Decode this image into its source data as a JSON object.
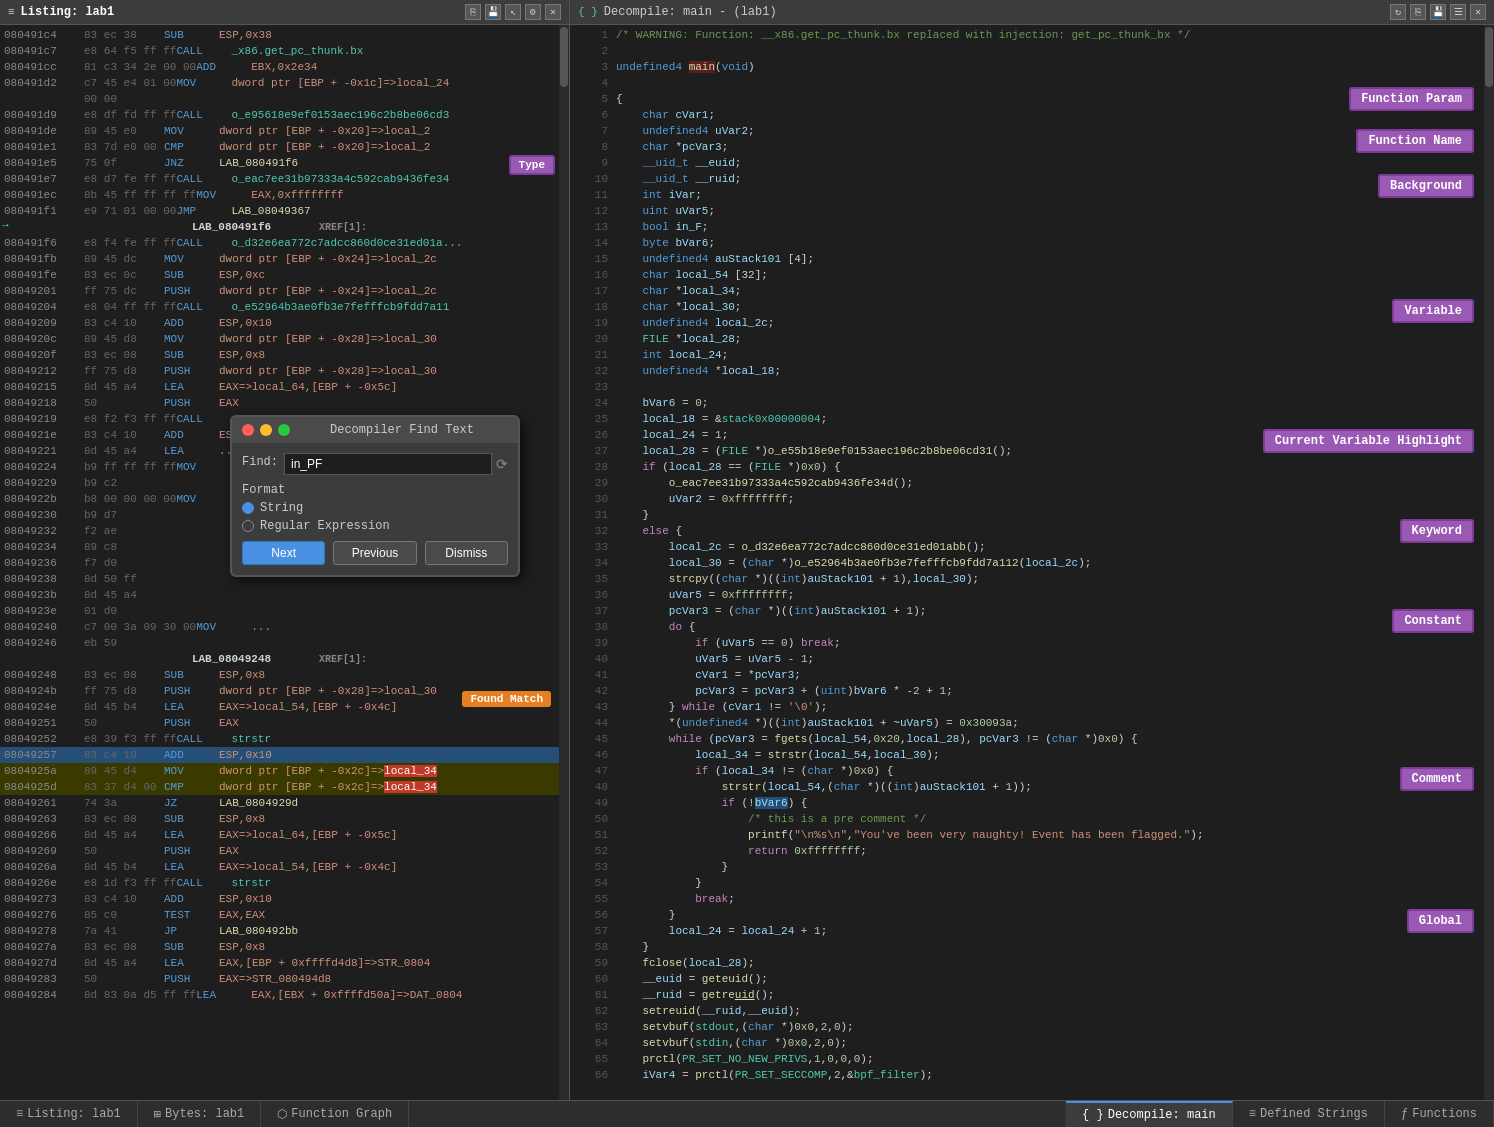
{
  "leftPanel": {
    "title": "Listing: lab1",
    "rows": [
      {
        "addr": "080491c4",
        "bytes": "83 ec 38",
        "mnem": "SUB",
        "operand": "ESP,0x38",
        "type": "normal"
      },
      {
        "addr": "080491c7",
        "bytes": "e8 64 f5 ff ff",
        "mnem": "CALL",
        "operand": "_x86.get_pc_thunk.bx",
        "type": "call"
      },
      {
        "addr": "080491cc",
        "bytes": "81 c3 34 2e 00 00",
        "mnem": "ADD",
        "operand": "EBX,0x2e34",
        "type": "normal"
      },
      {
        "addr": "080491d2",
        "bytes": "c7 45 e4 01 00",
        "mnem": "MOV",
        "operand": "dword ptr [EBP + -0x1c]=>local_24",
        "type": "normal"
      },
      {
        "addr": "",
        "bytes": "00 00",
        "mnem": "",
        "operand": "",
        "type": "continuation"
      },
      {
        "addr": "080491d9",
        "bytes": "e8 df fd ff ff",
        "mnem": "CALL",
        "operand": "o_e95618e9ef0153aec196c2b8be06cd3",
        "type": "call2"
      },
      {
        "addr": "080491de",
        "bytes": "89 45 e0",
        "mnem": "MOV",
        "operand": "dword ptr [EBP + -0x20]=>local_28",
        "type": "normal"
      },
      {
        "addr": "080491e1",
        "bytes": "83 7d e0 00",
        "mnem": "CMP",
        "operand": "dword ptr [EBP + -0x20]=>local_28",
        "type": "normal"
      },
      {
        "addr": "080491e5",
        "bytes": "75 0f",
        "mnem": "JNZ",
        "operand": "LAB_080491f6",
        "type": "normal"
      },
      {
        "addr": "080491e7",
        "bytes": "e8 d7 fe ff ff",
        "mnem": "CALL",
        "operand": "o_eac7ee31b97333a4c592cab9436fe34",
        "type": "call2"
      },
      {
        "addr": "080491ec",
        "bytes": "8b 45 ff ff ff ff",
        "mnem": "MOV",
        "operand": "EAX,0xffffffff",
        "type": "normal"
      },
      {
        "addr": "080491f1",
        "bytes": "e9 71 01 00 00",
        "mnem": "JMP",
        "operand": "LAB_08049367",
        "type": "normal"
      },
      {
        "label": "LAB_080491f6",
        "xref": "XREF[1]:",
        "type": "label"
      },
      {
        "addr": "080491f6",
        "bytes": "e8 f4 fe ff ff",
        "mnem": "CALL",
        "operand": "o_d32e6ea772c7adcc860d0ce31ed01a8",
        "type": "call2"
      },
      {
        "addr": "080491fb",
        "bytes": "89 45 dc",
        "mnem": "MOV",
        "operand": "dword ptr [EBP + -0x24]=>local_2c",
        "type": "normal"
      },
      {
        "addr": "080491fe",
        "bytes": "83 ec 0c",
        "mnem": "SUB",
        "operand": "ESP,0xc",
        "type": "normal"
      },
      {
        "addr": "08049201",
        "bytes": "ff 75 dc",
        "mnem": "PUSH",
        "operand": "dword ptr [EBP + -0x24]=>local_2c",
        "type": "normal"
      },
      {
        "addr": "08049204",
        "bytes": "e8 04 ff ff ff",
        "mnem": "CALL",
        "operand": "o_e52964b3ae0fb3e7fefffcb9fdd7a11",
        "type": "call2"
      },
      {
        "addr": "08049209",
        "bytes": "83 c4 10",
        "mnem": "ADD",
        "operand": "ESP,0x10",
        "type": "normal"
      },
      {
        "addr": "0804920c",
        "bytes": "89 45 d8",
        "mnem": "MOV",
        "operand": "dword ptr [EBP + -0x28]=>local_30",
        "type": "normal"
      },
      {
        "addr": "0804920f",
        "bytes": "83 ec 08",
        "mnem": "SUB",
        "operand": "ESP,0x8",
        "type": "normal"
      },
      {
        "addr": "08049212",
        "bytes": "ff 75 d8",
        "mnem": "PUSH",
        "operand": "dword ptr [EBP + -0x28]=>local_30",
        "type": "normal"
      },
      {
        "addr": "08049215",
        "bytes": "8d 45 a4",
        "mnem": "LEA",
        "operand": "EAX=>local_64,[EBP + -0x5c]",
        "type": "normal"
      },
      {
        "addr": "08049218",
        "bytes": "50",
        "mnem": "PUSH",
        "operand": "EAX",
        "type": "normal"
      },
      {
        "addr": "08049219",
        "bytes": "e8 f2 f3 ff ff",
        "mnem": "CALL",
        "operand": "strcpy",
        "type": "call"
      },
      {
        "addr": "0804921e",
        "bytes": "83 c4 10",
        "mnem": "ADD",
        "operand": "ESP,0x10",
        "type": "normal"
      },
      {
        "addr": "08049221",
        "bytes": "8d 45 a4",
        "mnem": "LEA",
        "operand": "...",
        "type": "normal"
      },
      {
        "addr": "08049224",
        "bytes": "b9 ff ff ff ff",
        "mnem": "MOV",
        "operand": "...",
        "type": "normal"
      },
      {
        "addr": "08049229",
        "bytes": "b9 c2",
        "mnem": "",
        "operand": "",
        "type": "normal"
      },
      {
        "addr": "0804922b",
        "bytes": "b9 c2",
        "mnem": "",
        "operand": "",
        "type": "normal"
      },
      {
        "addr": "0804922b",
        "bytes": "b8 00 00 00 00",
        "mnem": "MOV",
        "operand": "...",
        "type": "normal"
      },
      {
        "addr": "08049230",
        "bytes": "b9 d7",
        "mnem": "",
        "operand": "",
        "type": "normal"
      },
      {
        "addr": "08049232",
        "bytes": "f2 ae",
        "mnem": "",
        "operand": "",
        "type": "normal"
      },
      {
        "addr": "08049234",
        "bytes": "89 c8",
        "mnem": "",
        "operand": "",
        "type": "normal"
      },
      {
        "addr": "08049236",
        "bytes": "f7 d0",
        "mnem": "",
        "operand": "",
        "type": "normal"
      },
      {
        "addr": "08049238",
        "bytes": "8d 50 ff",
        "mnem": "",
        "operand": "",
        "type": "normal"
      },
      {
        "addr": "0804923b",
        "bytes": "8d 45 a4",
        "mnem": "",
        "operand": "",
        "type": "normal"
      },
      {
        "addr": "0804923e",
        "bytes": "01 d0",
        "mnem": "",
        "operand": "",
        "type": "normal"
      },
      {
        "addr": "08049240",
        "bytes": "c7 00 3a 09 30 00",
        "mnem": "MOV",
        "operand": "...",
        "type": "normal"
      },
      {
        "addr": "08049246",
        "bytes": "eb 59",
        "mnem": "",
        "operand": "",
        "type": "normal"
      },
      {
        "label": "LAB_08049248",
        "xref": "XREF[1]:",
        "type": "label"
      },
      {
        "addr": "08049248",
        "bytes": "83 ec 08",
        "mnem": "SUB",
        "operand": "ESP,0x8",
        "type": "normal"
      },
      {
        "addr": "0804924b",
        "bytes": "ff 75 d8",
        "mnem": "PUSH",
        "operand": "dword ptr [EBP + -0x28]=>local_30",
        "type": "normal"
      },
      {
        "addr": "0804924e",
        "bytes": "8d 45 b4",
        "mnem": "LEA",
        "operand": "EAX=>local_54,[EBP + -0x4c]",
        "type": "normal"
      },
      {
        "addr": "08049251",
        "bytes": "50",
        "mnem": "PUSH",
        "operand": "EAX",
        "type": "normal"
      },
      {
        "addr": "08049252",
        "bytes": "e8 39 f3 ff ff",
        "mnem": "CALL",
        "operand": "strstr",
        "type": "call"
      },
      {
        "addr": "08049257",
        "bytes": "83 c4 10",
        "mnem": "ADD",
        "operand": "ESP,0x10",
        "type": "normal"
      },
      {
        "addr": "0804925a",
        "bytes": "89 45 d4",
        "mnem": "MOV",
        "operand": "dword ptr [EBP + -0x2c]=>local_34",
        "type": "normal",
        "highlighted": true
      },
      {
        "addr": "0804925d",
        "bytes": "83 37 d4 00",
        "mnem": "CMP",
        "operand": "dword ptr [EBP + -0x2c]=>local_34",
        "type": "normal",
        "highlighted": true
      },
      {
        "addr": "08049261",
        "bytes": "74 3a",
        "mnem": "JZ",
        "operand": "LAB_0804929d",
        "type": "normal"
      },
      {
        "addr": "08049263",
        "bytes": "83 ec 08",
        "mnem": "SUB",
        "operand": "ESP,0x8",
        "type": "normal"
      },
      {
        "addr": "08049266",
        "bytes": "8d 45 a4",
        "mnem": "LEA",
        "operand": "EAX=>local_64,[EBP + -0x5c]",
        "type": "normal"
      },
      {
        "addr": "08049269",
        "bytes": "50",
        "mnem": "PUSH",
        "operand": "EAX",
        "type": "normal"
      },
      {
        "addr": "0804926a",
        "bytes": "8d 45 b4",
        "mnem": "LEA",
        "operand": "EAX=>local_54,[EBP + -0x4c]",
        "type": "normal"
      },
      {
        "addr": "0804926e",
        "bytes": "50",
        "mnem": "PUSH",
        "operand": "EAX",
        "type": "normal"
      },
      {
        "addr": "0804926e",
        "bytes": "e8 1d f3 ff ff",
        "mnem": "CALL",
        "operand": "strstr",
        "type": "call"
      },
      {
        "addr": "08049273",
        "bytes": "83 c4 10",
        "mnem": "ADD",
        "operand": "ESP,0x10",
        "type": "normal"
      },
      {
        "addr": "08049276",
        "bytes": "85 c0",
        "mnem": "TEST",
        "operand": "EAX,EAX",
        "type": "normal"
      },
      {
        "addr": "08049278",
        "bytes": "7a 41",
        "mnem": "JP",
        "operand": "LAB_080492bb",
        "type": "normal"
      },
      {
        "addr": "0804927a",
        "bytes": "83 ec 08",
        "mnem": "SUB",
        "operand": "ESP,0x8",
        "type": "normal"
      },
      {
        "addr": "0804927d",
        "bytes": "8d 45 a4",
        "mnem": "LEA",
        "operand": "EAX,[EBP + 0xffffd4d8]=>STR_0804",
        "type": "normal"
      },
      {
        "addr": "08049283",
        "bytes": "50",
        "mnem": "PUSH",
        "operand": "EAX=>STR_080494d8",
        "type": "normal"
      },
      {
        "addr": "08049284",
        "bytes": "8d 83 0a d5 ff ff",
        "mnem": "LEA",
        "operand": "EAX,[EBX + 0xffffd50a]=>DAT_0804",
        "type": "normal"
      }
    ]
  },
  "rightPanel": {
    "title": "Decompile: main - (lab1)",
    "lines": [
      {
        "num": 1,
        "content": "/* WARNING: Function: __x86.get_pc_thunk.bx replaced with injection: get_pc_thunk_bx */",
        "type": "comment"
      },
      {
        "num": 2,
        "content": "",
        "type": "blank"
      },
      {
        "num": 3,
        "content": "undefined4 main(void)",
        "type": "funcdef"
      },
      {
        "num": 4,
        "content": "",
        "type": "blank"
      },
      {
        "num": 5,
        "content": "{",
        "type": "punc"
      },
      {
        "num": 6,
        "content": "    char cVar1;",
        "type": "decl"
      },
      {
        "num": 7,
        "content": "    undefined4 uVar2;",
        "type": "decl"
      },
      {
        "num": 8,
        "content": "    char *pcVar3;",
        "type": "decl"
      },
      {
        "num": 9,
        "content": "    __uid_t __euid;",
        "type": "decl"
      },
      {
        "num": 10,
        "content": "    __uid_t __ruid;",
        "type": "decl"
      },
      {
        "num": 11,
        "content": "    int iVar;",
        "type": "decl"
      },
      {
        "num": 12,
        "content": "    uint uVar5;",
        "type": "decl"
      },
      {
        "num": 13,
        "content": "    bool in_F;",
        "type": "decl"
      },
      {
        "num": 14,
        "content": "    byte bVar6;",
        "type": "decl"
      },
      {
        "num": 15,
        "content": "    undefined4 auStack101 [4];",
        "type": "decl"
      },
      {
        "num": 16,
        "content": "    char local_54 [32];",
        "type": "decl"
      },
      {
        "num": 17,
        "content": "    char *local_34;",
        "type": "decl"
      },
      {
        "num": 18,
        "content": "    char *local_30;",
        "type": "decl"
      },
      {
        "num": 19,
        "content": "    undefined4 local_2c;",
        "type": "decl"
      },
      {
        "num": 20,
        "content": "    FILE *local_28;",
        "type": "decl"
      },
      {
        "num": 21,
        "content": "    int local_24;",
        "type": "decl"
      },
      {
        "num": 22,
        "content": "    undefined4 *local_18;",
        "type": "decl"
      },
      {
        "num": 23,
        "content": "",
        "type": "blank"
      },
      {
        "num": 24,
        "content": "    bVar6 = 0;",
        "type": "code"
      },
      {
        "num": 25,
        "content": "    local_18 = &stack0x00000004;",
        "type": "code"
      },
      {
        "num": 26,
        "content": "    local_24 = 1;",
        "type": "code"
      },
      {
        "num": 27,
        "content": "    local_28 = (FILE *)o_e55b18e9ef0153aec196c2b8be06cd31();",
        "type": "code"
      },
      {
        "num": 28,
        "content": "    if (local_28 == (FILE *)0x0) {",
        "type": "ctrl"
      },
      {
        "num": 29,
        "content": "        o_eac7ee31b97333a4c592cab9436fe34d();",
        "type": "code"
      },
      {
        "num": 30,
        "content": "        uVar2 = 0xffffffff;",
        "type": "code"
      },
      {
        "num": 31,
        "content": "    }",
        "type": "punc"
      },
      {
        "num": 32,
        "content": "    else {",
        "type": "ctrl"
      },
      {
        "num": 33,
        "content": "        local_2c = o_d32e6ea772c7adcc860d0ce31ed01abb();",
        "type": "code"
      },
      {
        "num": 34,
        "content": "        local_30 = (char *)o_e52964b3ae0fb3e7fefffcb9fdd7a112(local_2c);",
        "type": "code"
      },
      {
        "num": 35,
        "content": "        strcpy((char *)((int)auStack101 + 1),local_30);",
        "type": "code"
      },
      {
        "num": 36,
        "content": "        uVar5 = 0xffffffff;",
        "type": "code"
      },
      {
        "num": 37,
        "content": "        pcVar3 = (char *)((int)auStack101 + 1);",
        "type": "code"
      },
      {
        "num": 38,
        "content": "        do {",
        "type": "ctrl"
      },
      {
        "num": 39,
        "content": "            if (uVar5 == 0) break;",
        "type": "ctrl"
      },
      {
        "num": 40,
        "content": "            uVar5 = uVar5 - 1;",
        "type": "code"
      },
      {
        "num": 41,
        "content": "            cVar1 = *pcVar3;",
        "type": "code"
      },
      {
        "num": 42,
        "content": "            pcVar3 = pcVar3 + (uint)bVar6 * -2 + 1;",
        "type": "code"
      },
      {
        "num": 43,
        "content": "        } while (cVar1 != '\\0');",
        "type": "ctrl"
      },
      {
        "num": 44,
        "content": "        *(undefined4 *)((int)auStack101 + ~uVar5) = 0x30093a;",
        "type": "code"
      },
      {
        "num": 45,
        "content": "        while (pcVar3 = fgets(local_54,0x20,local_28), pcVar3 != (char *)0x0) {",
        "type": "ctrl"
      },
      {
        "num": 46,
        "content": "            local_34 = strstr(local_54,local_30);",
        "type": "code"
      },
      {
        "num": 47,
        "content": "            if (local_34 != (char *)0x0) {",
        "type": "ctrl"
      },
      {
        "num": 48,
        "content": "                strstr(local_54,(char *)((int)auStack101 + 1));",
        "type": "code"
      },
      {
        "num": 49,
        "content": "                if (!bVar6) {",
        "type": "ctrl"
      },
      {
        "num": 50,
        "content": "                    /* this is a pre comment */",
        "type": "comment"
      },
      {
        "num": 51,
        "content": "                    printf(\"\\n%s\\n\",\"You've been very naughty! Event has been flagged.\");",
        "type": "code"
      },
      {
        "num": 52,
        "content": "                    return 0xffffffff;",
        "type": "code"
      },
      {
        "num": 53,
        "content": "                }",
        "type": "punc"
      },
      {
        "num": 54,
        "content": "            }",
        "type": "punc"
      },
      {
        "num": 55,
        "content": "            break;",
        "type": "ctrl"
      },
      {
        "num": 56,
        "content": "        }",
        "type": "punc"
      },
      {
        "num": 57,
        "content": "        local_24 = local_24 + 1;",
        "type": "code"
      },
      {
        "num": 58,
        "content": "    }",
        "type": "punc"
      },
      {
        "num": 59,
        "content": "    fclose(local_28);",
        "type": "code"
      },
      {
        "num": 60,
        "content": "    __euid = geteuid();",
        "type": "code"
      },
      {
        "num": 61,
        "content": "    __ruid = getreuid();",
        "type": "code"
      },
      {
        "num": 62,
        "content": "    setreuid(__ruid,__euid);",
        "type": "code"
      },
      {
        "num": 63,
        "content": "    setvbuf(stdout,(char *)0x0,2,0);",
        "type": "code"
      },
      {
        "num": 64,
        "content": "    setvbuf(stdin,(char *)0x0,2,0);",
        "type": "code"
      },
      {
        "num": 65,
        "content": "    prctl(PR_SET_NO_NEW_PRIVS,1,0,0,0);",
        "type": "code"
      },
      {
        "num": 66,
        "content": "    iVar4 = prctl(PR_SET_SECCOMP,2,&bpf_filter);",
        "type": "code"
      }
    ]
  },
  "findDialog": {
    "title": "Decompiler Find Text",
    "findLabel": "Find:",
    "findValue": "in_PF",
    "formatLabel": "Format",
    "option1": "String",
    "option2": "Regular Expression",
    "btn1": "Next",
    "btn2": "Previous",
    "btn3": "Dismiss"
  },
  "annotations": {
    "functionParam": "Function Param",
    "functionName": "Function Name",
    "background": "Background",
    "type": "Type",
    "variable": "Variable",
    "keyword": "Keyword",
    "currentVariableHighlight": "Current Variable Highlight",
    "constant": "Constant",
    "foundMatch": "Found Match",
    "comment": "Comment",
    "global": "Global"
  },
  "bottomTabs": {
    "left": [
      {
        "label": "Listing: lab1",
        "icon": "≡",
        "active": false
      },
      {
        "label": "Bytes: lab1",
        "icon": "⊞",
        "active": false
      },
      {
        "label": "Function Graph",
        "icon": "⬡",
        "active": false
      }
    ],
    "right": [
      {
        "label": "Decompile: main",
        "icon": "{ }",
        "active": true
      },
      {
        "label": "Defined Strings",
        "icon": "≡",
        "active": false
      },
      {
        "label": "Functions",
        "icon": "ƒ",
        "active": false
      }
    ]
  }
}
